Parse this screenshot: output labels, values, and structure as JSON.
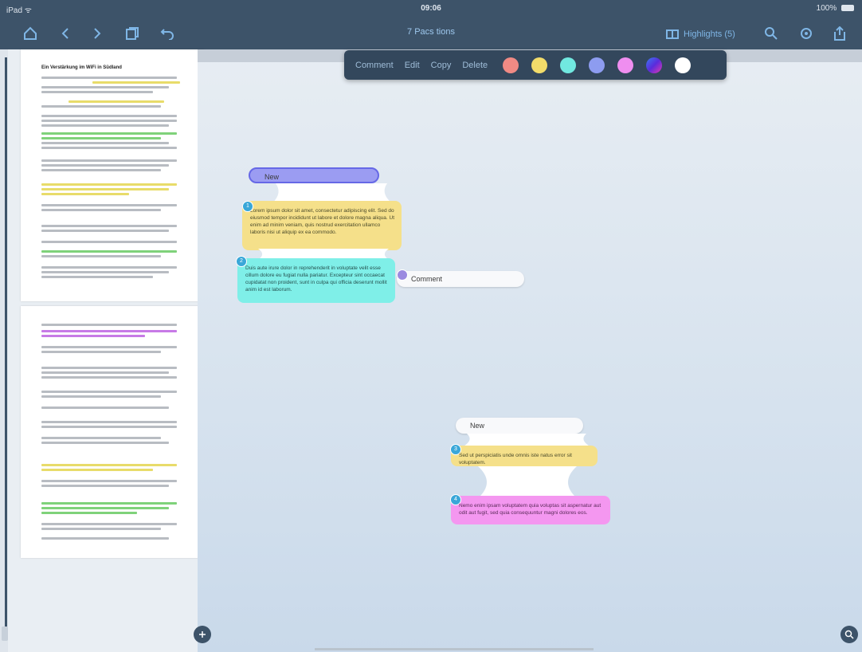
{
  "status_bar": {
    "left": "iPad ᯤ",
    "time": "09:06",
    "right": "100% "
  },
  "toolbar": {
    "document_title": "7 Pacs tions",
    "highlights_label": "Highlights (5)"
  },
  "thumbnails": {
    "page1_title": "Ein Verstärkung im WiFi in Südland"
  },
  "context_menu": {
    "items": [
      "Comment",
      "Edit",
      "Copy",
      "Delete"
    ],
    "colors": [
      "#f08a84",
      "#f2dc6a",
      "#71e8e0",
      "#8d9cf0",
      "#ef8ef0",
      "#5a2bdc",
      "#ffffff"
    ]
  },
  "mindmap": {
    "node1_label": "New",
    "card1_text": "Lorem ipsum dolor sit amet, consectetur adipiscing elit. Sed do eiusmod tempor incididunt ut labore et dolore magna aliqua. Ut enim ad minim veniam, quis nostrud exercitation ullamco laboris nisi ut aliquip ex ea commodo.",
    "card2_text": "Duis aute irure dolor in reprehenderit in voluptate velit esse cillum dolore eu fugiat nulla pariatur. Excepteur sint occaecat cupidatat non proident, sunt in culpa qui officia deserunt mollit anim id est laborum.",
    "card2_note": "Comment",
    "node2_label": "New",
    "card3_text": "Sed ut perspiciatis unde omnis iste natus error sit voluptatem.",
    "card4_text": "Nemo enim ipsam voluptatem quia voluptas sit aspernatur aut odit aut fugit, sed quia consequuntur magni dolores eos."
  },
  "colors": {
    "toolbar_bg": "#3d5369",
    "accent": "#7fb6e6",
    "badge": "#3aa7d8"
  }
}
